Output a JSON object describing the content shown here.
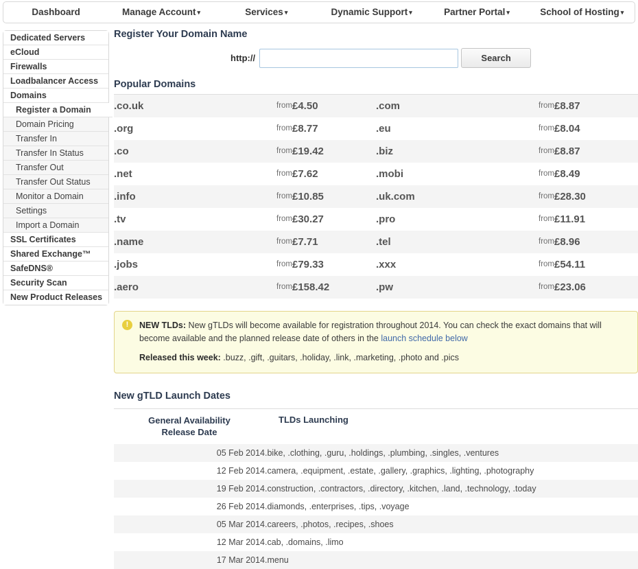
{
  "topnav": {
    "items": [
      {
        "label": "Dashboard",
        "caret": false
      },
      {
        "label": "Manage Account",
        "caret": true
      },
      {
        "label": "Services",
        "caret": true
      },
      {
        "label": "Dynamic Support",
        "caret": true
      },
      {
        "label": "Partner Portal",
        "caret": true
      },
      {
        "label": "School of Hosting",
        "caret": true
      }
    ],
    "caret_glyph": "▾"
  },
  "sidebar": {
    "items": [
      {
        "label": "Dedicated Servers",
        "sub": false,
        "active": false
      },
      {
        "label": "eCloud",
        "sub": false,
        "active": false
      },
      {
        "label": "Firewalls",
        "sub": false,
        "active": false
      },
      {
        "label": "Loadbalancer Access",
        "sub": false,
        "active": false
      },
      {
        "label": "Domains",
        "sub": false,
        "active": false
      },
      {
        "label": "Register a Domain",
        "sub": true,
        "active": true
      },
      {
        "label": "Domain Pricing",
        "sub": true,
        "active": false
      },
      {
        "label": "Transfer In",
        "sub": true,
        "active": false
      },
      {
        "label": "Transfer In Status",
        "sub": true,
        "active": false
      },
      {
        "label": "Transfer Out",
        "sub": true,
        "active": false
      },
      {
        "label": "Transfer Out Status",
        "sub": true,
        "active": false
      },
      {
        "label": "Monitor a Domain",
        "sub": true,
        "active": false
      },
      {
        "label": "Settings",
        "sub": true,
        "active": false
      },
      {
        "label": "Import a Domain",
        "sub": true,
        "active": false
      },
      {
        "label": "SSL Certificates",
        "sub": false,
        "active": false
      },
      {
        "label": "Shared Exchange™",
        "sub": false,
        "active": false
      },
      {
        "label": "SafeDNS®",
        "sub": false,
        "active": false
      },
      {
        "label": "Security Scan",
        "sub": false,
        "active": false
      },
      {
        "label": "New Product Releases",
        "sub": false,
        "active": false
      }
    ]
  },
  "register": {
    "title": "Register Your Domain Name",
    "protocol_label": "http://",
    "input_value": "",
    "input_placeholder": "",
    "search_label": "Search"
  },
  "popular": {
    "title": "Popular Domains",
    "from_label": "from",
    "rows": [
      {
        "left_tld": ".co.uk",
        "left_price": "£4.50",
        "right_tld": ".com",
        "right_price": "£8.87"
      },
      {
        "left_tld": ".org",
        "left_price": "£8.77",
        "right_tld": ".eu",
        "right_price": "£8.04"
      },
      {
        "left_tld": ".co",
        "left_price": "£19.42",
        "right_tld": ".biz",
        "right_price": "£8.87"
      },
      {
        "left_tld": ".net",
        "left_price": "£7.62",
        "right_tld": ".mobi",
        "right_price": "£8.49"
      },
      {
        "left_tld": ".info",
        "left_price": "£10.85",
        "right_tld": ".uk.com",
        "right_price": "£28.30"
      },
      {
        "left_tld": ".tv",
        "left_price": "£30.27",
        "right_tld": ".pro",
        "right_price": "£11.91"
      },
      {
        "left_tld": ".name",
        "left_price": "£7.71",
        "right_tld": ".tel",
        "right_price": "£8.96"
      },
      {
        "left_tld": ".jobs",
        "left_price": "£79.33",
        "right_tld": ".xxx",
        "right_price": "£54.11"
      },
      {
        "left_tld": ".aero",
        "left_price": "£158.42",
        "right_tld": ".pw",
        "right_price": "£23.06"
      }
    ]
  },
  "alert": {
    "icon": "exclamation-icon",
    "icon_glyph": "!",
    "heading": "NEW TLDs:",
    "body_before_link": " New gTLDs will become available for registration throughout 2014. You can check the exact domains that will become available and the planned release date of others in the ",
    "link_text": "launch schedule below",
    "released_label": "Released this week:",
    "released_list": " .buzz, .gift, .guitars, .holiday, .link, .marketing, .photo and .pics"
  },
  "launch": {
    "title": "New gTLD Launch Dates",
    "col_date_line1": "General Availability",
    "col_date_line2": "Release Date",
    "col_tlds": "TLDs Launching",
    "rows": [
      {
        "date": "05 Feb 2014",
        "tlds": ".bike, .clothing, .guru, .holdings, .plumbing, .singles, .ventures"
      },
      {
        "date": "12 Feb 2014",
        "tlds": ".camera, .equipment, .estate, .gallery, .graphics, .lighting, .photography"
      },
      {
        "date": "19 Feb 2014",
        "tlds": ".construction, .contractors, .directory, .kitchen, .land, .technology, .today"
      },
      {
        "date": "26 Feb 2014",
        "tlds": ".diamonds, .enterprises, .tips, .voyage"
      },
      {
        "date": "05 Mar 2014",
        "tlds": ".careers, .photos, .recipes, .shoes"
      },
      {
        "date": "12 Mar 2014",
        "tlds": ".cab, .domains, .limo"
      },
      {
        "date": "17 Mar 2014",
        "tlds": ".menu"
      }
    ]
  },
  "colors": {
    "heading": "#2d3b50",
    "alert_bg": "#fcfce3",
    "alert_border": "#e3d48a",
    "alert_icon": "#e8cf3f",
    "link": "#4169a8",
    "row_stripe": "#f4f4f4",
    "input_border": "#a7c6e0"
  }
}
